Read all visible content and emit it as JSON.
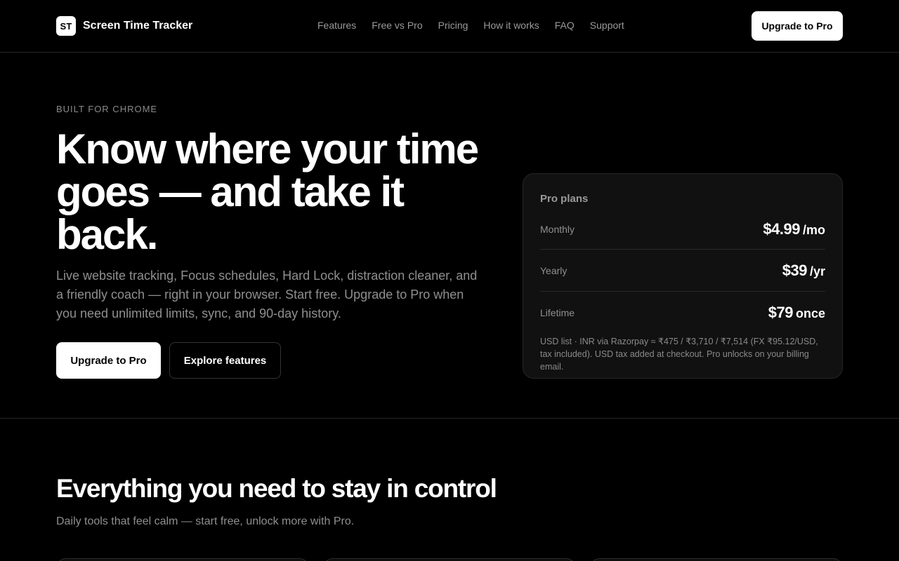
{
  "header": {
    "logo_text": "ST",
    "brand_name": "Screen Time Tracker",
    "nav": [
      "Features",
      "Free vs Pro",
      "Pricing",
      "How it works",
      "FAQ",
      "Support"
    ],
    "cta_label": "Upgrade to Pro"
  },
  "hero": {
    "eyebrow": "BUILT FOR CHROME",
    "title": "Know where your time goes — and take it back.",
    "subtitle": "Live website tracking, Focus schedules, Hard Lock, distraction cleaner, and a friendly coach — right in your browser. Start free. Upgrade to Pro when you need unlimited limits, sync, and 90-day history.",
    "primary_cta": "Upgrade to Pro",
    "secondary_cta": "Explore features"
  },
  "plans": {
    "title": "Pro plans",
    "items": [
      {
        "name": "Monthly",
        "price": "$4.99",
        "unit": "/mo"
      },
      {
        "name": "Yearly",
        "price": "$39",
        "unit": "/yr"
      },
      {
        "name": "Lifetime",
        "price": "$79",
        "unit": "once"
      }
    ],
    "note": "USD list · INR via Razorpay ≈ ₹475 / ₹3,710 / ₹7,514 (FX ₹95.12/USD, tax included). USD tax added at checkout. Pro unlocks on your billing email."
  },
  "features_section": {
    "title": "Everything you need to stay in control",
    "subtitle": "Daily tools that feel calm — start free, unlock more with Pro."
  },
  "colors": {
    "background": "#000000",
    "card": "#111111",
    "border": "#262626",
    "muted_text": "#8f8f8f",
    "accent": "#ffffff"
  }
}
